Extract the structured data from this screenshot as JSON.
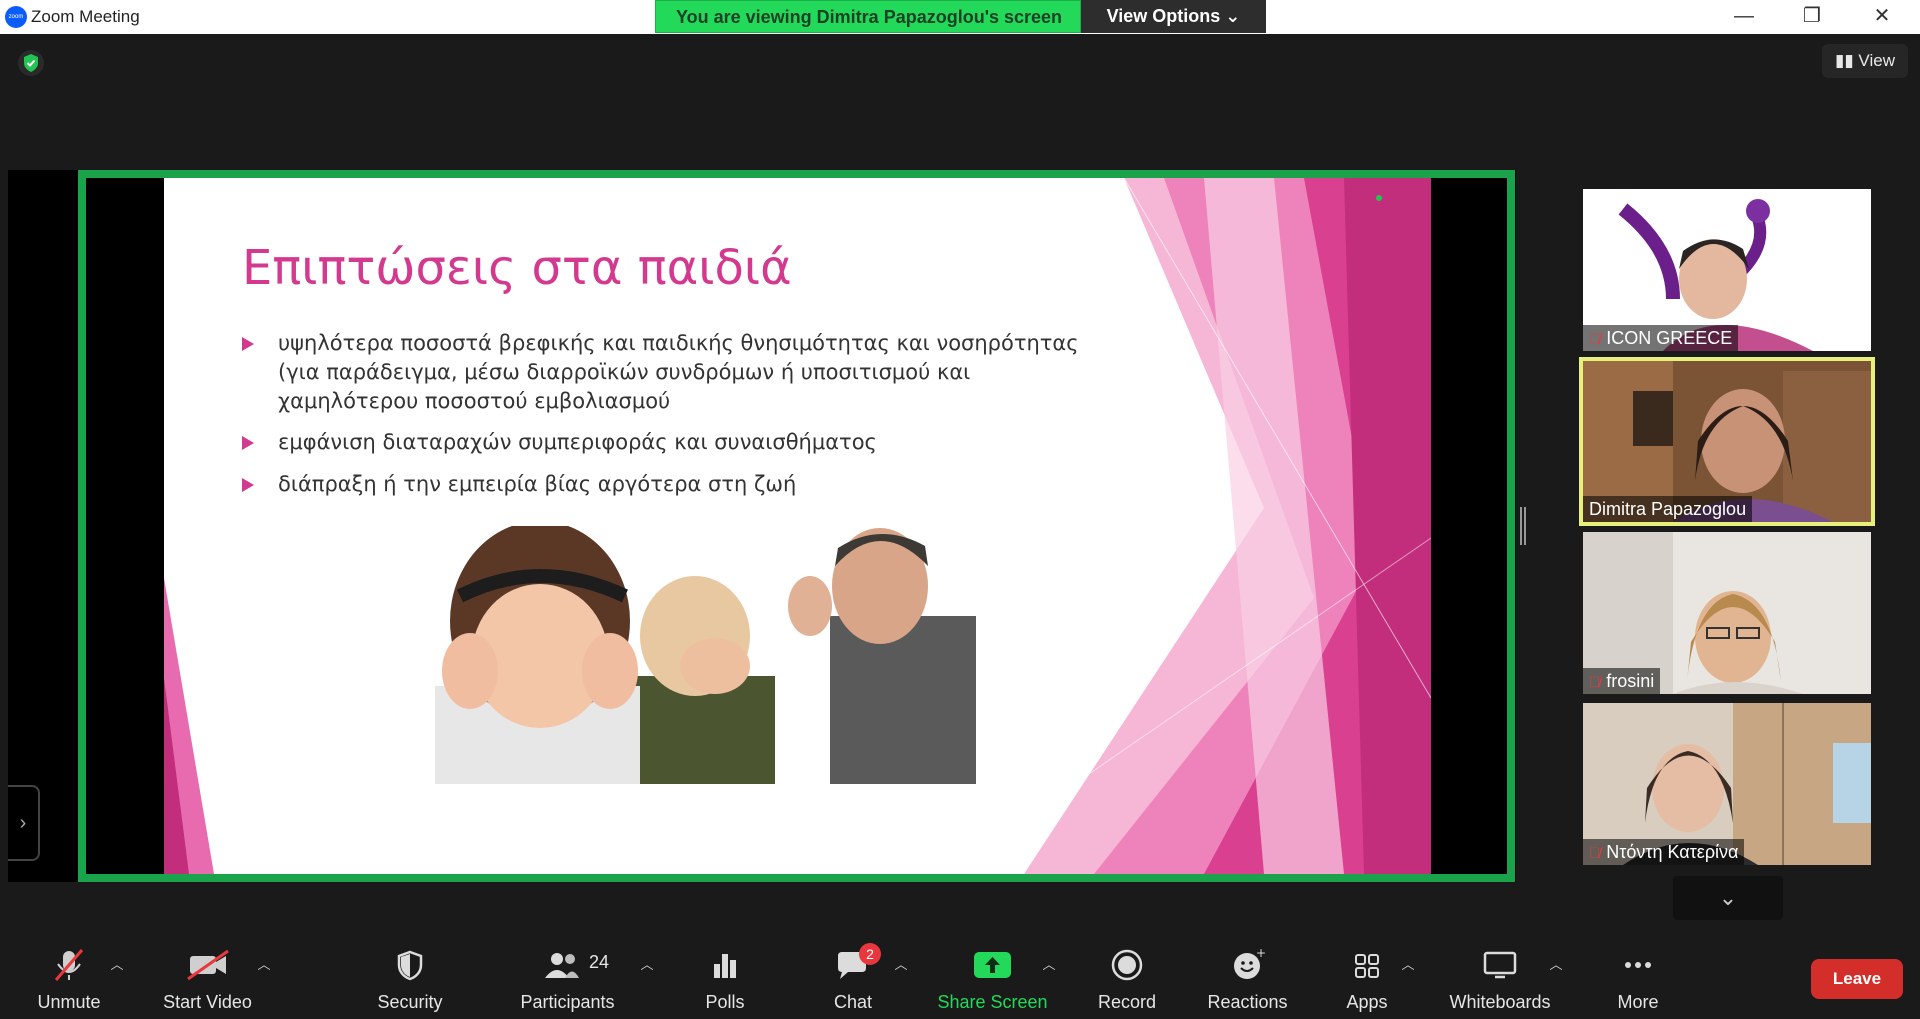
{
  "window": {
    "app_title": "Zoom Meeting",
    "banner_text": "You are viewing Dimitra Papazoglou's screen",
    "view_options_label": "View Options ⌄",
    "minimize": "—",
    "restore": "❐",
    "close": "✕"
  },
  "top": {
    "view_label": "▮▮ View"
  },
  "slide": {
    "title": "Επιπτώσεις στα παιδιά",
    "bullets": [
      "υψηλότερα ποσοστά βρεφικής και παιδικής θνησιμότητας και νοσηρότητας (για παράδειγμα, μέσω διαρροϊκών συνδρόμων ή υποσιτισμού και χαμηλότερου ποσοστού εμβολιασμού",
      "εμφάνιση διαταραχών συμπεριφοράς και συναισθήματος",
      "διάπραξη ή την εμπειρία βίας αργότερα στη ζωή"
    ],
    "accent_color": "#d33a8f"
  },
  "participants": [
    {
      "name": "ICON GREECE",
      "muted": true
    },
    {
      "name": "Dimitra Papazoglou",
      "muted": false
    },
    {
      "name": "frosini",
      "muted": true
    },
    {
      "name": "Ντόντη Κατερίνα",
      "muted": true
    }
  ],
  "toolbar": {
    "unmute": "Unmute",
    "start_video": "Start Video",
    "security": "Security",
    "participants": "Participants",
    "participants_count": "24",
    "polls": "Polls",
    "chat": "Chat",
    "chat_badge": "2",
    "share_screen": "Share Screen",
    "record": "Record",
    "reactions": "Reactions",
    "apps": "Apps",
    "whiteboards": "Whiteboards",
    "more": "More",
    "leave": "Leave"
  },
  "colors": {
    "share_border": "#1aa34a",
    "banner": "#23d959",
    "share_screen_icon": "#23d959",
    "leave": "#d32e2a",
    "active_speaker": "#e7f07b"
  }
}
